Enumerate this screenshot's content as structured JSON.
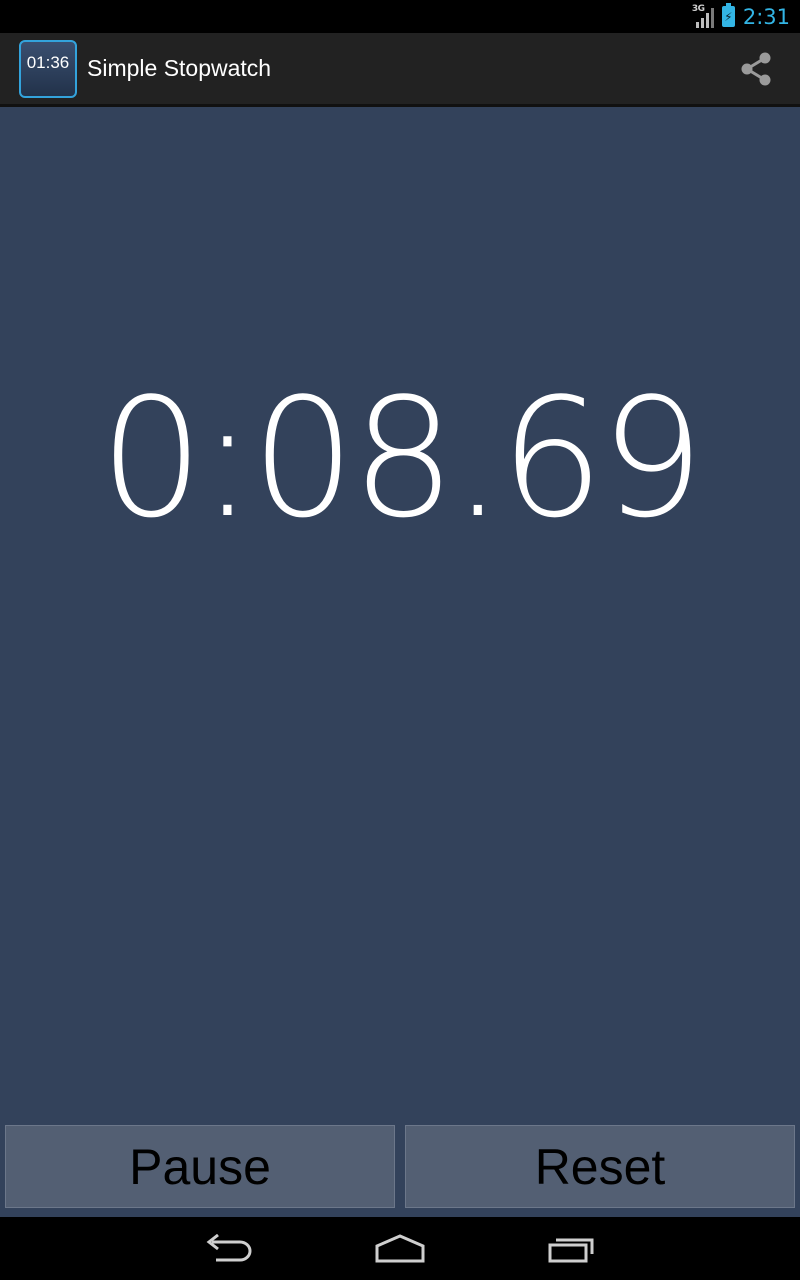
{
  "status_bar": {
    "network": "3G",
    "time": "2:31",
    "battery_icon": "battery-charging-icon",
    "signal_icon": "signal-icon"
  },
  "action_bar": {
    "app_icon_text": "01:36",
    "title": "Simple Stopwatch",
    "share_icon": "share-icon"
  },
  "main": {
    "timer": "0:08.69",
    "pause_label": "Pause",
    "reset_label": "Reset"
  },
  "nav_bar": {
    "back_icon": "back-icon",
    "home_icon": "home-icon",
    "recents_icon": "recents-icon"
  },
  "colors": {
    "accent": "#33b5e5",
    "background": "#33425b",
    "button": "#535f73",
    "action_bar": "#222222"
  }
}
